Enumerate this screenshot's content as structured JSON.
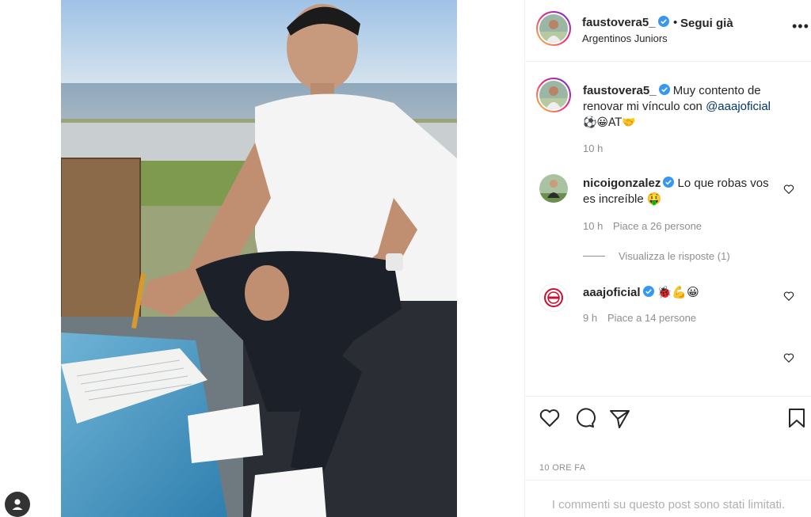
{
  "post": {
    "author": "faustovera5_",
    "follow_state": "Segui già",
    "separator": "•",
    "location": "Argentinos Juniors",
    "more_icon": "more-options-icon"
  },
  "caption": {
    "author": "faustovera5_",
    "text_before": "Muy contento de renovar mi vínculo con ",
    "mention": "@aaajoficial",
    "emojis": "⚽😀AT🤝",
    "time": "10 h"
  },
  "comments": [
    {
      "author": "nicoigonzalez",
      "text": "Lo que robas vos es increíble 🤑",
      "time": "10 h",
      "likes": "Piace a 26 persone",
      "view_replies": "Visualizza le risposte (1)"
    },
    {
      "author": "aaajoficial",
      "text": "🐞💪😀",
      "time": "9 h",
      "likes": "Piace a 14 persone"
    }
  ],
  "footer": {
    "time_ago": "10 ORE FA",
    "comments_limited": "I commenti su questo post sono stati limitati."
  },
  "colors": {
    "verified": "#3897f0",
    "mention": "#00376b",
    "secondary_text": "#8e8e8e",
    "divider": "#efefef"
  },
  "icons": [
    "like-icon",
    "comment-icon",
    "share-icon",
    "save-icon",
    "heart-small-icon",
    "verified-badge-icon",
    "profile-icon"
  ]
}
